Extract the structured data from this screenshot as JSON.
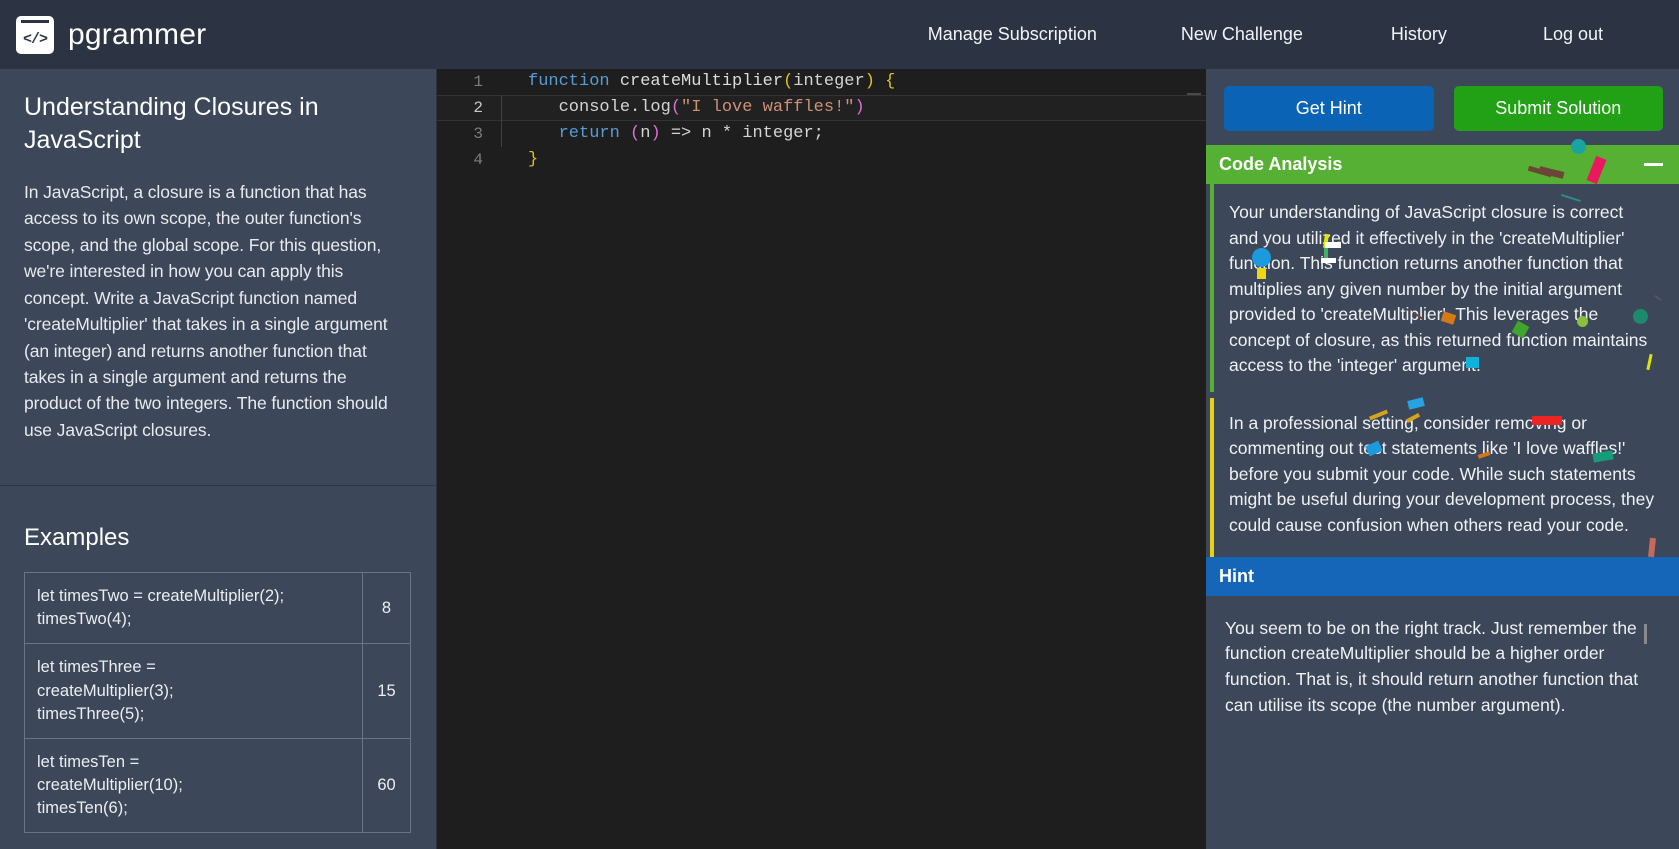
{
  "nav": {
    "brand": "pgrammer",
    "logo_glyph": "</>",
    "links": [
      "Manage Subscription",
      "New Challenge",
      "History",
      "Log out"
    ]
  },
  "problem": {
    "title": "Understanding Closures in JavaScript",
    "description": "In JavaScript, a closure is a function that has access to its own scope, the outer function's scope, and the global scope. For this question, we're interested in how you can apply this concept. Write a JavaScript function named 'createMultiplier' that takes in a single argument (an integer) and returns another function that takes in a single argument and returns the product of the two integers. The function should use JavaScript closures.",
    "examples_heading": "Examples",
    "examples": [
      {
        "input_lines": [
          "let timesTwo = createMultiplier(2);",
          "timesTwo(4);"
        ],
        "output": "8"
      },
      {
        "input_lines": [
          "let timesThree =",
          "createMultiplier(3);",
          "timesThree(5);"
        ],
        "output": "15"
      },
      {
        "input_lines": [
          "let timesTen =",
          "createMultiplier(10);",
          "timesTen(6);"
        ],
        "output": "60"
      }
    ]
  },
  "editor": {
    "active_line": 2,
    "lines": [
      {
        "number": "1",
        "text": "function createMultiplier(integer) {"
      },
      {
        "number": "2",
        "text": "    console.log(\"I love waffles!\")"
      },
      {
        "number": "3",
        "text": "    return (n) => n * integer;"
      },
      {
        "number": "4",
        "text": "}"
      }
    ]
  },
  "actions": {
    "get_hint_label": "Get Hint",
    "submit_solution_label": "Submit Solution",
    "get_hint_color": "#0b63b5",
    "submit_solution_color": "#22a116"
  },
  "code_analysis": {
    "header": "Code Analysis",
    "header_color": "#56b033",
    "minimize_icon": "minimize-icon",
    "paragraphs": [
      "Your understanding of JavaScript closure is correct and you utilized it effectively in the 'createMultiplier' function. This function returns another function that multiplies any given number by the initial argument provided to 'createMultiplier'. This leverages the concept of closure, as this returned function maintains access to the 'integer' argument.",
      "In a professional setting, consider removing or commenting out test statements like 'I love waffles!' before you submit your code. While such statements might be useful during your development process, they could cause confusion when others read your code."
    ],
    "accent_colors": [
      "#56b033",
      "#e8d018"
    ]
  },
  "hint": {
    "header": "Hint",
    "header_color": "#1565b8",
    "body": "You seem to be on the right track. Just remember the function createMultiplier should be a higher order function. That is, it should return another function that can utilise its scope (the number argument)."
  },
  "theme": {
    "nav_background": "#2c3444",
    "panel_background": "#3c4759",
    "editor_background": "#1e1e1e",
    "text_primary": "#ffffff"
  }
}
